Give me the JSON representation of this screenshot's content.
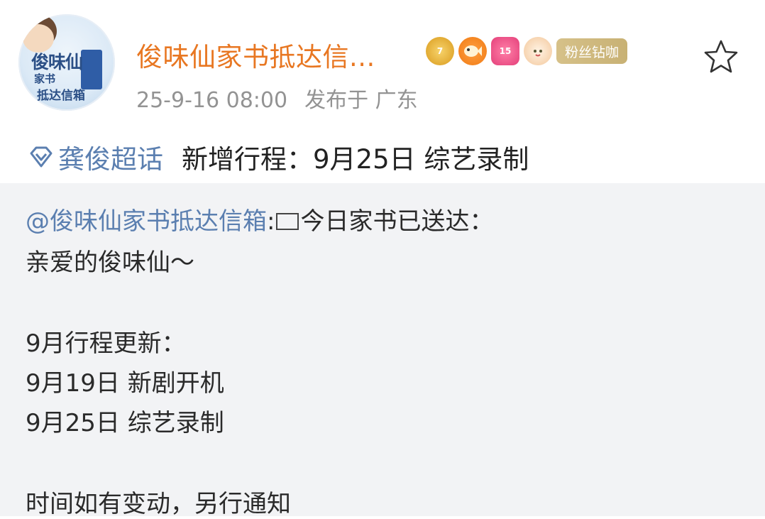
{
  "post": {
    "username": "俊味仙家书抵达信...",
    "timestamp": "25-9-16 08:00",
    "location": "发布于 广东",
    "fan_badge_label": "粉丝钻咖",
    "heart_badge_level": "15",
    "crown_badge_level": "7",
    "avatar": {
      "line1": "俊味仙",
      "line2": "家书",
      "line3": "抵达信箱"
    },
    "topic_tag": "龚俊超话",
    "topic_title": "新增行程：9月25日 综艺录制",
    "icons": [
      "crown-badge-icon",
      "fish-badge-icon",
      "heart-level-badge-icon",
      "bun-mascot-icon",
      "favorite-star-icon",
      "diamond-topic-icon",
      "mail-icon"
    ],
    "colors": {
      "username": "#e87722",
      "link": "#5b7fb0",
      "meta": "#939393",
      "repost_bg": "#f2f3f5"
    }
  },
  "repost": {
    "mention": "@俊味仙家书抵达信箱",
    "after_mention": ":",
    "intro": "今日家书已送达：",
    "lines": [
      "亲爱的俊味仙～",
      "9月行程更新：",
      "9月19日 新剧开机",
      "9月25日 综艺录制",
      "时间如有变动，另行通知"
    ]
  }
}
